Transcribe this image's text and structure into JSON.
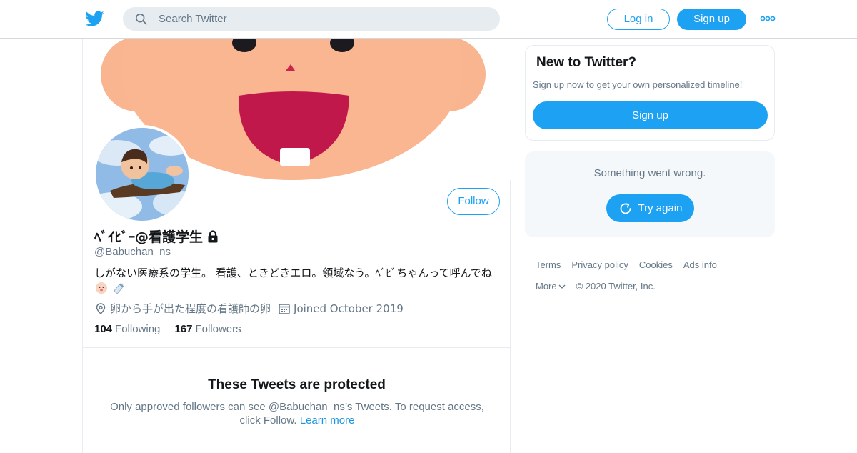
{
  "header": {
    "search_placeholder": "Search Twitter",
    "login_label": "Log in",
    "signup_label": "Sign up"
  },
  "profile": {
    "display_name": "ﾍﾞｲﾋﾞｰ@看護学生",
    "handle": "@Babuchan_ns",
    "bio": "しがない医療系の学生。 看護、ときどきエロ。領域なう。ﾍﾞﾋﾞちゃんって呼んでね",
    "location": "卵から手が出た程度の看護師の卵",
    "joined": "Joined October 2019",
    "following_count": "104",
    "following_label": "Following",
    "followers_count": "167",
    "followers_label": "Followers",
    "follow_label": "Follow"
  },
  "protected": {
    "title": "These Tweets are protected",
    "text": "Only approved followers can see @Babuchan_ns’s Tweets. To request access, click Follow.",
    "learn_more": "Learn more"
  },
  "sidebar": {
    "new_title": "New to Twitter?",
    "new_sub": "Sign up now to get your own personalized timeline!",
    "signup_label": "Sign up",
    "error_text": "Something went wrong.",
    "try_again_label": "Try again"
  },
  "footer": {
    "links": [
      "Terms",
      "Privacy policy",
      "Cookies",
      "Ads info"
    ],
    "more_label": "More",
    "copyright": "© 2020 Twitter, Inc."
  },
  "colors": {
    "accent": "#1da1f2",
    "text_secondary": "#657786",
    "link": "#1b95e0"
  }
}
